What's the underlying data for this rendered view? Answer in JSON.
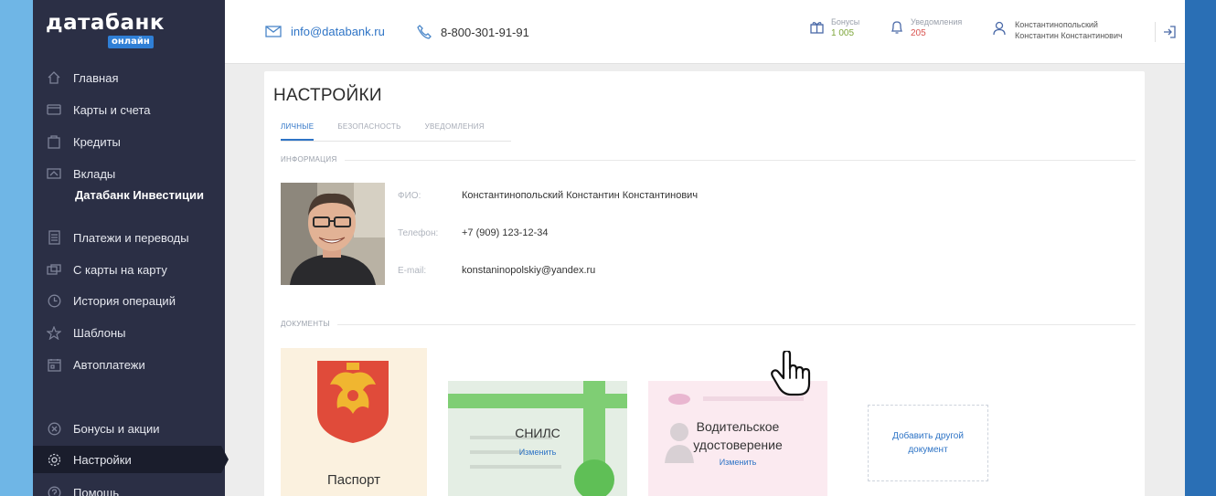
{
  "brand": {
    "name": "датабанк",
    "badge": "онлайн"
  },
  "sidebar": {
    "items": [
      {
        "label": "Главная",
        "icon": "home-icon"
      },
      {
        "label": "Карты и счета",
        "icon": "card-icon"
      },
      {
        "label": "Кредиты",
        "icon": "bag-icon"
      },
      {
        "label": "Вклады",
        "icon": "deposit-icon"
      },
      {
        "label": "Платежи и переводы",
        "icon": "document-icon"
      },
      {
        "label": "С карты на карту",
        "icon": "transfer-icon"
      },
      {
        "label": "История операций",
        "icon": "clock-icon"
      },
      {
        "label": "Шаблоны",
        "icon": "star-icon"
      },
      {
        "label": "Автоплатежи",
        "icon": "calendar-icon"
      },
      {
        "label": "Бонусы и акции",
        "icon": "gift-icon"
      },
      {
        "label": "Настройки",
        "icon": "gear-icon"
      },
      {
        "label": "Помощь",
        "icon": "help-icon"
      }
    ],
    "sub_item": "Датабанк Инвестиции",
    "active": "Настройки"
  },
  "header": {
    "email": "info@databank.ru",
    "phone": "8-800-301-91-91",
    "bonus": {
      "label": "Бонусы",
      "value": "1 005"
    },
    "notifications": {
      "label": "Уведомления",
      "value": "205"
    },
    "user": {
      "line1": "Константинопольский",
      "line2": "Константин Константинович"
    }
  },
  "page": {
    "title": "НАСТРОЙКИ",
    "tabs": [
      {
        "label": "Личные",
        "active": true
      },
      {
        "label": "Безопасность",
        "active": false
      },
      {
        "label": "Уведомления",
        "active": false
      }
    ],
    "info_section": "Информация",
    "fields": [
      {
        "label": "ФИО:",
        "value": "Константинопольский Константин Константинович"
      },
      {
        "label": "Телефон:",
        "value": "+7 (909) 123-12-34"
      },
      {
        "label": "E-mail:",
        "value": "konstaninopolskiy@yandex.ru"
      }
    ],
    "documents_section": "Документы",
    "documents": {
      "passport": "Паспорт",
      "snils": "СНИЛС",
      "snils_edit": "Изменить",
      "license_line1": "Водительское",
      "license_line2": "удостоверение",
      "license_edit": "Изменить",
      "add_line1": "Добавить другой",
      "add_line2": "документ"
    }
  },
  "colors": {
    "sidebar_bg": "#2b2f45",
    "accent": "#2e74c6",
    "bonus": "#7da63a",
    "notifications": "#d9534f"
  }
}
